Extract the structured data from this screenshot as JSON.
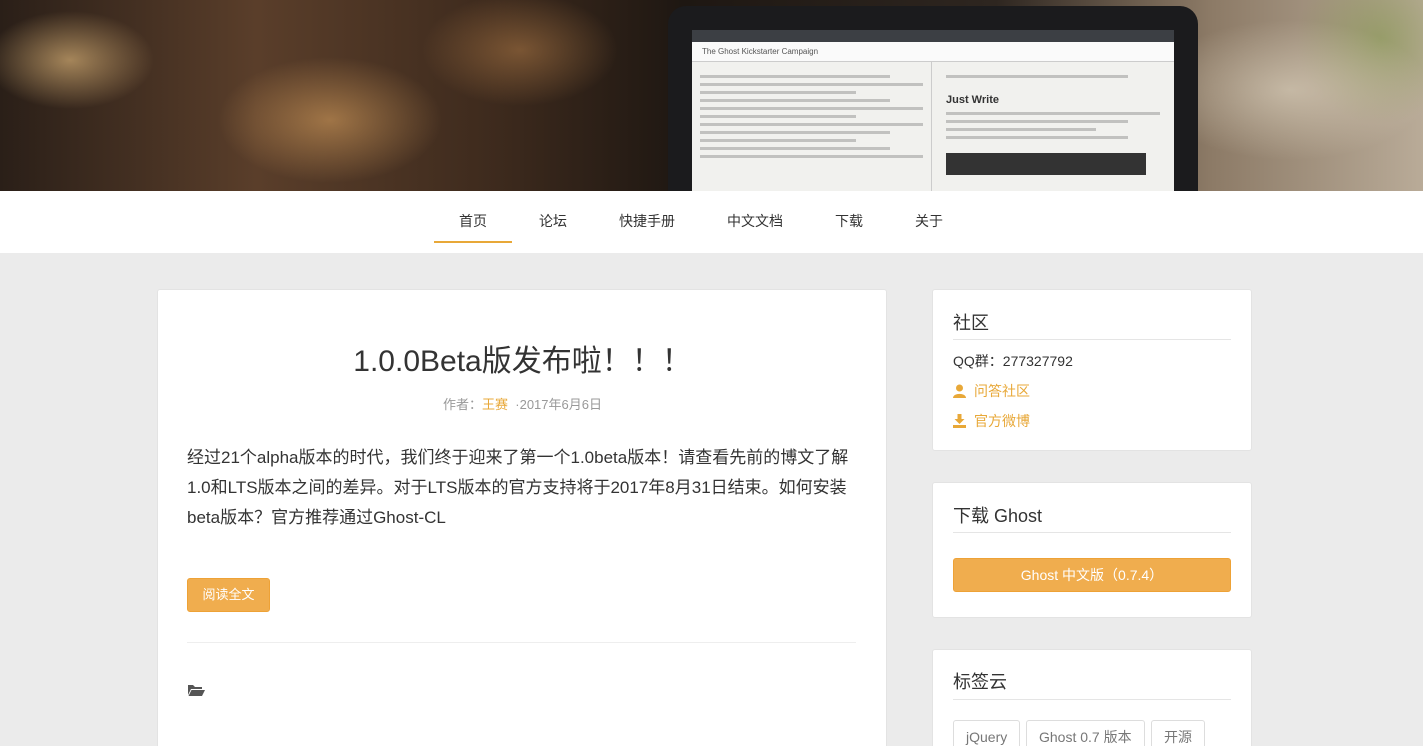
{
  "nav": {
    "items": [
      {
        "label": "首页"
      },
      {
        "label": "论坛"
      },
      {
        "label": "快捷手册"
      },
      {
        "label": "中文文档"
      },
      {
        "label": "下载"
      },
      {
        "label": "关于"
      }
    ]
  },
  "hero": {
    "screen_title": "The Ghost Kickstarter Campaign",
    "screen_heading": "Just Write"
  },
  "post": {
    "title": "1.0.0Beta版发布啦！！！",
    "author_prefix": "作者：",
    "author": "王赛",
    "date": "·2017年6月6日",
    "excerpt": "经过21个alpha版本的时代，我们终于迎来了第一个1.0beta版本！请查看先前的博文了解1.0和LTS版本之间的差异。对于LTS版本的官方支持将于2017年8月31日结束。如何安装beta版本？官方推荐通过Ghost-CL",
    "read_more": "阅读全文"
  },
  "community": {
    "title": "社区",
    "qq": "QQ群：277327792",
    "link1": "问答社区",
    "link2": "官方微博"
  },
  "download": {
    "title": "下载 Ghost",
    "button": "Ghost 中文版（0.7.4）"
  },
  "tags": {
    "title": "标签云",
    "items": [
      "jQuery",
      "Ghost 0.7 版本",
      "开源"
    ]
  },
  "colors": {
    "accent": "#e8a838",
    "button": "#f0ad4e"
  }
}
